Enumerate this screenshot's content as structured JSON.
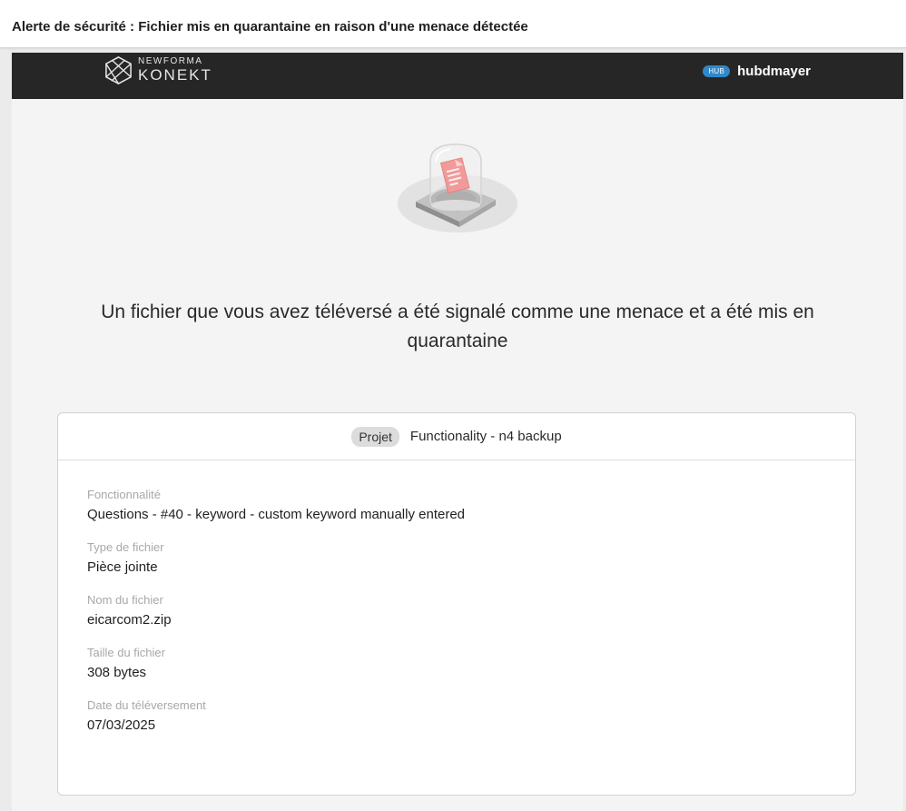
{
  "email": {
    "subject": "Alerte de sécurité : Fichier mis en quarantaine en raison d'une menace détectée"
  },
  "header": {
    "logo_top": "NEWFORMA",
    "logo_bottom": "KONEKT",
    "hub_badge": "HUB",
    "hub_name": "hubdmayer"
  },
  "illustration": {
    "icon": "quarantined-file-dome-icon",
    "accent_color": "#f19a9a"
  },
  "message": {
    "headline": "Un fichier que vous avez téléversé a été signalé comme une menace et a été mis en quarantaine"
  },
  "card": {
    "project_label": "Projet",
    "project_name": "Functionality - n4 backup",
    "fields": [
      {
        "label": "Fonctionnalité",
        "value": "Questions - #40 - keyword - custom keyword manually entered"
      },
      {
        "label": "Type de fichier",
        "value": "Pièce jointe"
      },
      {
        "label": "Nom du fichier",
        "value": "eicarcom2.zip"
      },
      {
        "label": "Taille du fichier",
        "value": "308 bytes"
      },
      {
        "label": "Date du téléversement",
        "value": "07/03/2025"
      }
    ]
  },
  "colors": {
    "header_bg": "#262626",
    "hub_badge": "#2f88c9",
    "page_bg": "#f4f4f4"
  }
}
